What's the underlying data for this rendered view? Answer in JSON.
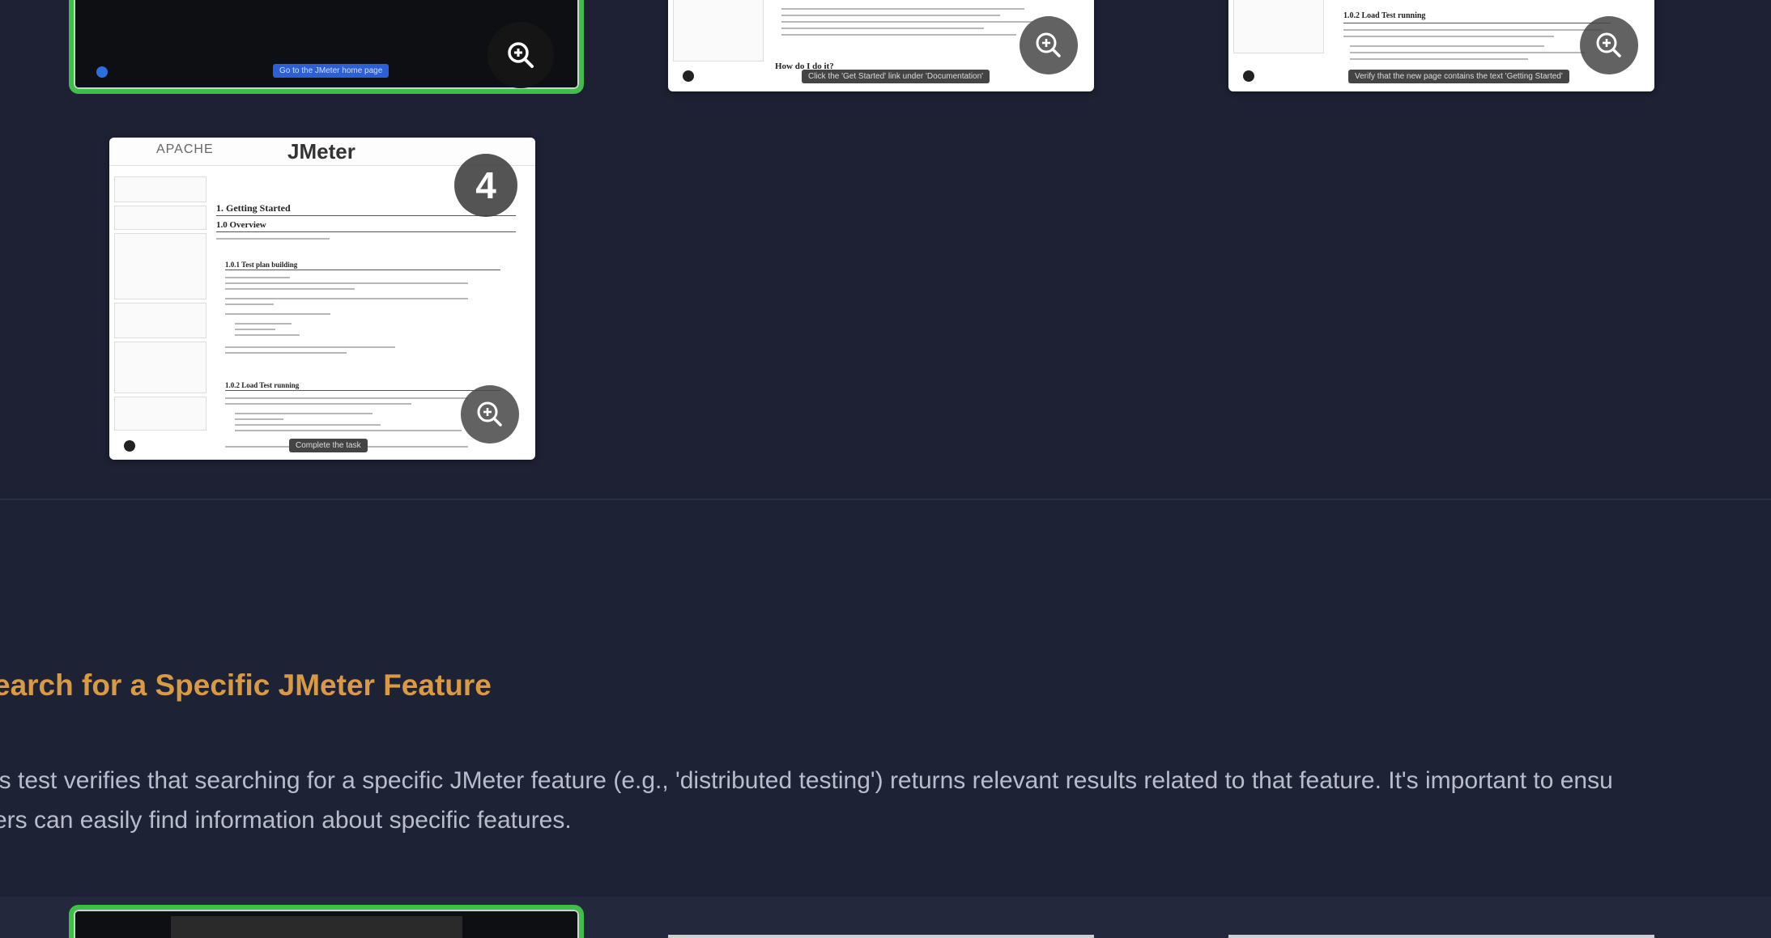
{
  "screenshots": [
    {
      "name": "step-3-screenshot",
      "button_text": "Go to the JMeter home page"
    },
    {
      "name": "step-1-screenshot",
      "tooltip": "Click the 'Get Started' link under 'Documentation'",
      "doc_heading": "How do I do it?"
    },
    {
      "name": "step-2-screenshot",
      "tooltip": "Verify that the new page contains the text 'Getting Started'",
      "doc_heading": "1.0.2 Load Test running"
    },
    {
      "name": "step-4-screenshot",
      "step_number": "4",
      "tooltip": "Complete the task",
      "header_logo": "APACHE",
      "header_title": "JMeter",
      "doc_title": "1. Getting Started",
      "doc_subtitle": "1.0 Overview",
      "doc_section_1": "1.0.1 Test plan building",
      "doc_section_2": "1.0.2 Load Test running"
    }
  ],
  "section": {
    "title": "earch for a Specific JMeter Feature",
    "description_line_1": "is test verifies that searching for a specific JMeter feature (e.g., 'distributed testing') returns relevant results related to that feature. It's important to ensu",
    "description_line_2": "ers can easily find information about specific features."
  },
  "colors": {
    "background": "#1e2235",
    "title": "#d99a45",
    "body_text": "#b9bccb",
    "active_border": "#3fbf4a"
  },
  "icons": [
    "zoom-in-icon"
  ]
}
